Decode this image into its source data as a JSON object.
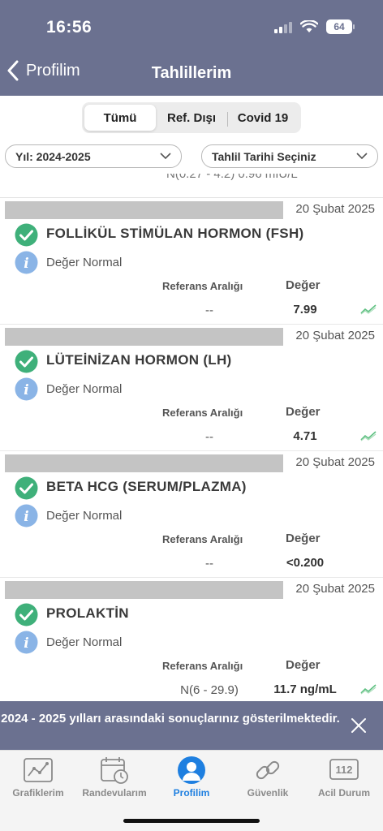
{
  "status_bar": {
    "time": "16:56",
    "battery": "64"
  },
  "header": {
    "back_label": "Profilim",
    "title": "Tahlillerim"
  },
  "segments": [
    "Tümü",
    "Ref. Dışı",
    "Covid 19"
  ],
  "filters": {
    "year": "Yıl: 2024-2025",
    "date": "Tahlil Tarihi Seçiniz"
  },
  "partial_row_text": "N(0.27 - 4.2)        0.96 mIU/L",
  "labels": {
    "reference": "Referans Aralığı",
    "value": "Değer"
  },
  "results": [
    {
      "date": "20 Şubat 2025",
      "name": "FOLLİKÜL STİMÜLAN HORMON (FSH)",
      "status": "Değer Normal",
      "reference": "--",
      "value": "7.99"
    },
    {
      "date": "20 Şubat 2025",
      "name": "LÜTEİNİZAN HORMON (LH)",
      "status": "Değer Normal",
      "reference": "--",
      "value": "4.71"
    },
    {
      "date": "20 Şubat 2025",
      "name": "BETA HCG (SERUM/PLAZMA)",
      "status": "Değer Normal",
      "reference": "--",
      "value": "<0.200"
    },
    {
      "date": "20 Şubat 2025",
      "name": "PROLAKTİN",
      "status": "Değer Normal",
      "reference": "N(6 - 29.9)",
      "value": "11.7 ng/mL"
    }
  ],
  "toast": {
    "message": "2024 - 2025 yılları arasındaki sonuçlarınız gösterilmektedir."
  },
  "tabs": [
    {
      "label": "Grafiklerim",
      "icon": "chart-icon"
    },
    {
      "label": "Randevularım",
      "icon": "calendar-icon"
    },
    {
      "label": "Profilim",
      "icon": "profile-icon"
    },
    {
      "label": "Güvenlik",
      "icon": "link-icon"
    },
    {
      "label": "Acil Durum",
      "icon": "emergency-112-icon",
      "badge": "112"
    }
  ],
  "colors": {
    "header": "#6b7190",
    "check": "#3fb07a",
    "info": "#8ab4e6",
    "active_tab": "#1e7fe0",
    "trend": "#5cbf80"
  }
}
